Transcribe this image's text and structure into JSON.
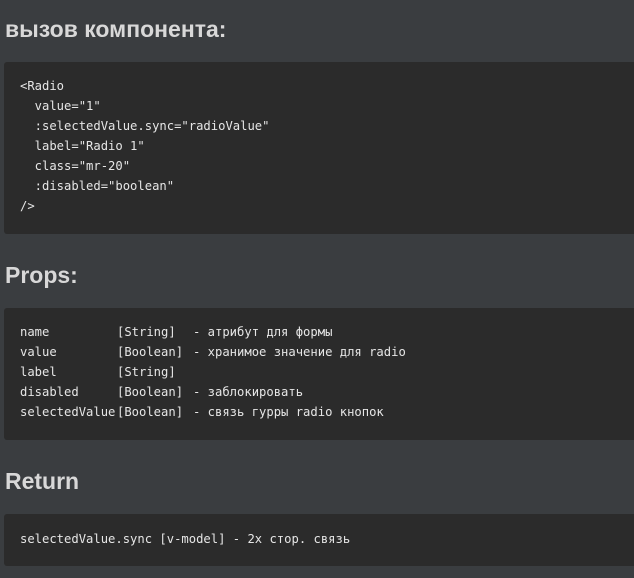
{
  "sections": {
    "usage": {
      "title": "вызов компонента:",
      "code_lines": [
        "<Radio",
        "  value=\"1\"",
        "  :selectedValue.sync=\"radioValue\"",
        "  label=\"Radio 1\"",
        "  class=\"mr-20\"",
        "  :disabled=\"boolean\"",
        "/>"
      ]
    },
    "props": {
      "title": "Props:",
      "rows": [
        {
          "name": "name",
          "type": "[String]",
          "desc": "- атрибут для формы"
        },
        {
          "name": "value",
          "type": "[Boolean]",
          "desc": "- хранимое значение для radio"
        },
        {
          "name": "label",
          "type": "[String]",
          "desc": ""
        },
        {
          "name": "disabled",
          "type": "[Boolean]",
          "desc": "- заблокировать"
        },
        {
          "name": "selectedValue",
          "type": "[Boolean]",
          "desc": "- связь гурры radio кнопок"
        }
      ]
    },
    "return": {
      "title": "Return",
      "code_line": "selectedValue.sync [v-model] - 2x стор. связь"
    }
  }
}
